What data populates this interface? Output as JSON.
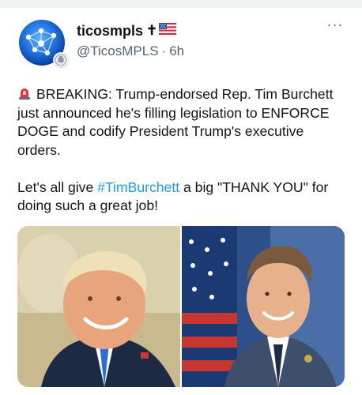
{
  "post": {
    "author": {
      "display_name": "ticosmpls",
      "name_suffix": "✝",
      "handle": "@TicosMPLS",
      "time_separator": "·",
      "time_ago": "6h",
      "avatar_icon": "globe-network-icon",
      "badge_icon": "seal-badge-icon"
    },
    "more_label": "···",
    "text": {
      "line1_prefix": "BREAKING: Trump-endorsed Rep. Tim Burchett just announced he's filling legislation to ENFORCE DOGE and codify President Trump's executive orders.",
      "line2_before": "Let's all give ",
      "hashtag": "#TimBurchett",
      "line2_after": " a big \"THANK YOU\" for doing such a great job!"
    },
    "media": {
      "images": [
        "photo-left",
        "photo-right"
      ]
    }
  },
  "colors": {
    "link": "#1d9bf0",
    "secondary_text": "#536471",
    "primary_text": "#0f1419"
  }
}
